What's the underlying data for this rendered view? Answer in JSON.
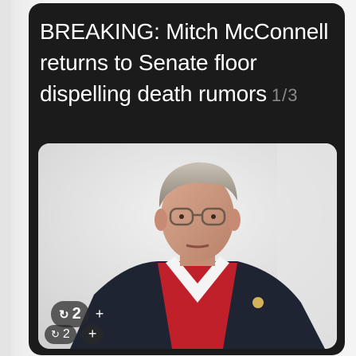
{
  "post": {
    "headline": "BREAKING: Mitch McConnell returns to Senate floor dispelling death rumors",
    "page_counter": "1/3"
  },
  "photo": {
    "description_icon": "person-photo"
  },
  "overlay": {
    "repost_count": "2",
    "repost_icon": "repost-icon",
    "add_label": "+",
    "small_count": "2",
    "small_icon": "repost-icon",
    "small_add_label": "+"
  },
  "colors": {
    "card_bg": "#1b1b1b",
    "text": "#ffffff",
    "counter": "#8a8a8a",
    "suit": "#1f2433",
    "sweater": "#c0202a"
  }
}
